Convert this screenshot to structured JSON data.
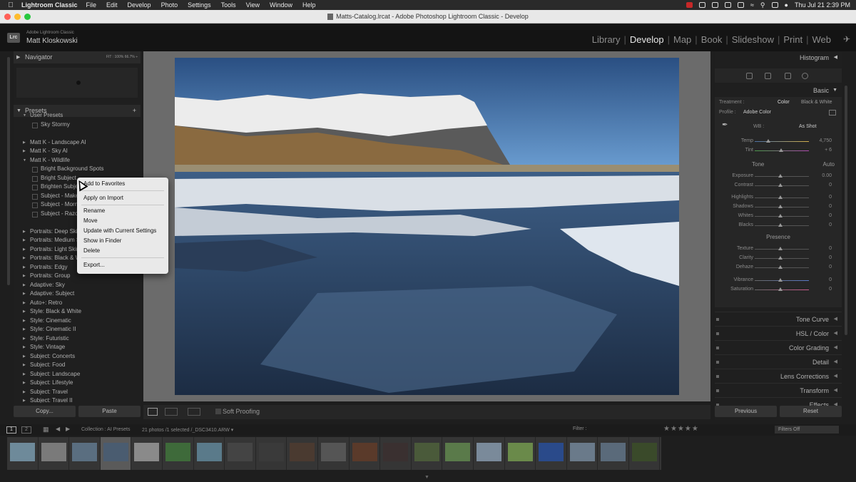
{
  "menubar": {
    "app_name": "Lightroom Classic",
    "items": [
      "File",
      "Edit",
      "Develop",
      "Photo",
      "Settings",
      "Tools",
      "View",
      "Window",
      "Help"
    ],
    "clock": "Thu Jul 21  2:39 PM"
  },
  "window": {
    "title": "Matts-Catalog.lrcat - Adobe Photoshop Lightroom Classic - Develop"
  },
  "identity": {
    "logo": "Lrc",
    "small": "Adobe Lightroom Classic",
    "name": "Matt Kloskowski"
  },
  "modules": {
    "items": [
      "Library",
      "Develop",
      "Map",
      "Book",
      "Slideshow",
      "Print",
      "Web"
    ],
    "active": "Develop"
  },
  "navigator": {
    "title": "Navigator",
    "zoom_options": "FIT :   100%   66.7%  ÷"
  },
  "presets": {
    "title": "Presets",
    "items": [
      {
        "label": "User Presets",
        "level": 0,
        "open": true
      },
      {
        "label": "Sky Stormy",
        "level": 1
      },
      {
        "label": "",
        "level": -1
      },
      {
        "label": "Matt K - Landscape AI",
        "level": 0
      },
      {
        "label": "Matt K - Sky AI",
        "level": 0
      },
      {
        "label": "Matt K - Wildlife",
        "level": 0,
        "open": true
      },
      {
        "label": "Bright Background Spots",
        "level": 1
      },
      {
        "label": "Bright Subject",
        "level": 1
      },
      {
        "label": "Brighten Subje",
        "level": 1
      },
      {
        "label": "Subject - Make",
        "level": 1
      },
      {
        "label": "Subject - Morni",
        "level": 1
      },
      {
        "label": "Subject - Razor",
        "level": 1
      },
      {
        "label": "",
        "level": -1
      },
      {
        "label": "Portraits: Deep Skin",
        "level": 0
      },
      {
        "label": "Portraits: Medium S",
        "level": 0
      },
      {
        "label": "Portraits: Light Skin",
        "level": 0
      },
      {
        "label": "Portraits: Black & W",
        "level": 0
      },
      {
        "label": "Portraits: Edgy",
        "level": 0
      },
      {
        "label": "Portraits: Group",
        "level": 0
      },
      {
        "label": "Adaptive: Sky",
        "level": 0
      },
      {
        "label": "Adaptive: Subject",
        "level": 0
      },
      {
        "label": "Auto+: Retro",
        "level": 0
      },
      {
        "label": "Style: Black & White",
        "level": 0
      },
      {
        "label": "Style: Cinematic",
        "level": 0
      },
      {
        "label": "Style: Cinematic II",
        "level": 0
      },
      {
        "label": "Style: Futuristic",
        "level": 0
      },
      {
        "label": "Style: Vintage",
        "level": 0
      },
      {
        "label": "Subject: Concerts",
        "level": 0
      },
      {
        "label": "Subject: Food",
        "level": 0
      },
      {
        "label": "Subject: Landscape",
        "level": 0
      },
      {
        "label": "Subject: Lifestyle",
        "level": 0
      },
      {
        "label": "Subject: Travel",
        "level": 0
      },
      {
        "label": "Subject: Travel II",
        "level": 0
      }
    ],
    "copy_label": "Copy...",
    "paste_label": "Paste"
  },
  "context_menu": {
    "add_favorites": "Add to Favorites",
    "apply_import": "Apply on Import",
    "rename": "Rename",
    "move": "Move",
    "update": "Update with Current Settings",
    "show_finder": "Show in Finder",
    "delete": "Delete",
    "export": "Export..."
  },
  "toolbar": {
    "soft_proofing": "Soft Proofing"
  },
  "right": {
    "histogram": "Histogram",
    "basic": "Basic",
    "treatment_label": "Treatment :",
    "color": "Color",
    "bw": "Black & White",
    "profile_label": "Profile :",
    "profile_value": "Adobe Color",
    "wb_label": "WB :",
    "wb_value": "As Shot",
    "tone": "Tone",
    "auto": "Auto",
    "presence": "Presence",
    "temp": {
      "label": "Temp",
      "value": "4,750"
    },
    "tint": {
      "label": "Tint",
      "value": "+ 6"
    },
    "exposure": {
      "label": "Exposure",
      "value": "0.00"
    },
    "contrast": {
      "label": "Contrast",
      "value": "0"
    },
    "highlights": {
      "label": "Highlights",
      "value": "0"
    },
    "shadows": {
      "label": "Shadows",
      "value": "0"
    },
    "whites": {
      "label": "Whites",
      "value": "0"
    },
    "blacks": {
      "label": "Blacks",
      "value": "0"
    },
    "texture": {
      "label": "Texture",
      "value": "0"
    },
    "clarity": {
      "label": "Clarity",
      "value": "0"
    },
    "dehaze": {
      "label": "Dehaze",
      "value": "0"
    },
    "vibrance": {
      "label": "Vibrance",
      "value": "0"
    },
    "saturation": {
      "label": "Saturation",
      "value": "0"
    },
    "panels": [
      "Tone Curve",
      "HSL / Color",
      "Color Grading",
      "Detail",
      "Lens Corrections",
      "Transform",
      "Effects"
    ],
    "previous": "Previous",
    "reset": "Reset"
  },
  "filmstrip": {
    "page1": "1",
    "page2": "2",
    "collection": "Collection : AI Presets",
    "count": "21 photos /1 selected /_DSC3410.ARW ▾",
    "filter_label": "Filter :",
    "filter_value": "Filters Off",
    "stars": "★★★★★",
    "thumbs": [
      "#6e8a9a",
      "#7a7a7a",
      "#5a6e80",
      "#4a5c70",
      "#8a8a8a",
      "#3e6a3a",
      "#5a7a8a",
      "#444",
      "#3a3a3a",
      "#4a3a30",
      "#555",
      "#5a3a2a",
      "#3a3030",
      "#4a5a3a",
      "#5a7a4a",
      "#7a8a9a",
      "#6a8a4a",
      "#2a4a8a",
      "#6a7a8a",
      "#5a6a7a",
      "#3a4a2a"
    ],
    "selected_index": 3
  }
}
